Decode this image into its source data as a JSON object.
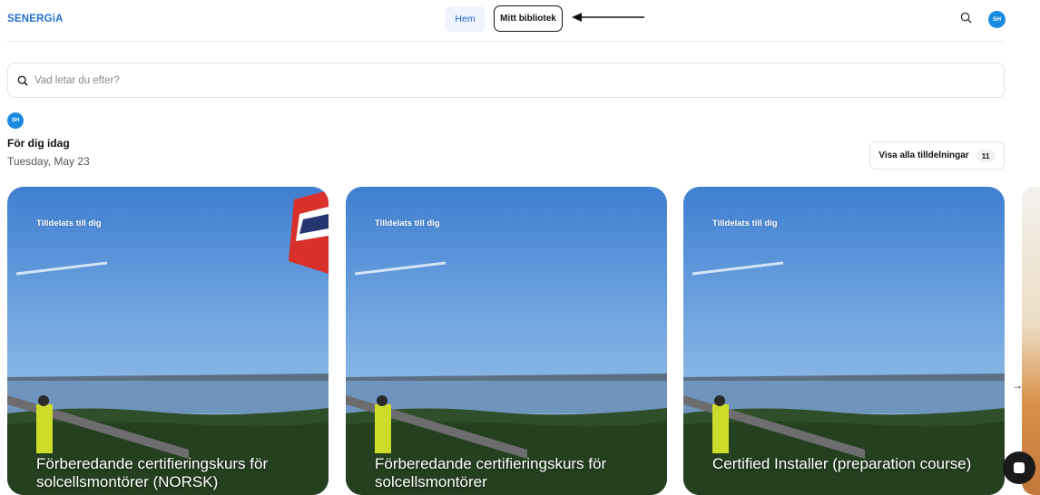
{
  "header": {
    "logo": "SENERGiA",
    "nav": {
      "home_label": "Hem",
      "library_label": "Mitt bibliotek"
    },
    "user_initials": "SH"
  },
  "search": {
    "placeholder": "Vad letar du efter?"
  },
  "feed": {
    "user_initials": "SH",
    "title": "För dig idag",
    "date": "Tuesday, May 23",
    "see_all": {
      "label": "Visa alla tilldelningar",
      "count": "11"
    }
  },
  "cards": [
    {
      "tag": "Tilldelats till dig",
      "title": "Förberedande certifieringskurs för solcellsmontörer (NORSK)"
    },
    {
      "tag": "Tilldelats till dig",
      "title": "Förberedande certifieringskurs för solcellsmontörer"
    },
    {
      "tag": "Tilldelats till dig",
      "title": "Certified Installer (preparation course)"
    }
  ],
  "icons": {
    "search": "search-icon",
    "arrow": "arrow-left-icon",
    "next": "arrow-right-icon",
    "chat": "chat-icon"
  },
  "colors": {
    "accent": "#1f6fd1",
    "avatar": "#1b8be0",
    "hem_bg": "#eef3fd"
  }
}
